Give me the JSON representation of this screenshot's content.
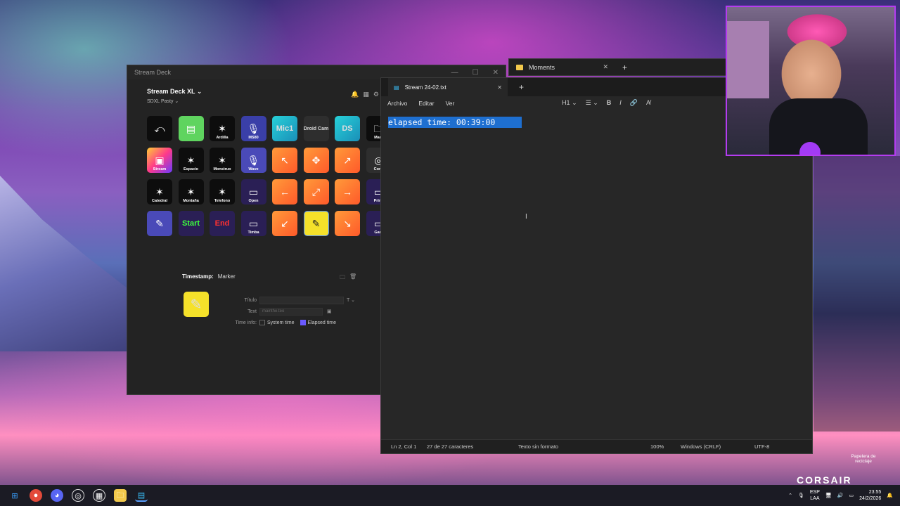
{
  "streamdeck": {
    "window_title": "Stream Deck",
    "device": "Stream Deck XL",
    "profile": "SDXL Pasty",
    "keys": [
      {
        "label": "",
        "icon": "back-icon",
        "glyph": "⤺"
      },
      {
        "label": "",
        "icon": "document-icon",
        "glyph": "▤"
      },
      {
        "label": "Ardilla",
        "icon": "corsair-icon",
        "glyph": "✶"
      },
      {
        "label": "MS80",
        "icon": "microphone-icon",
        "glyph": "🎙"
      },
      {
        "label": "",
        "icon": "mic-text",
        "glyph": "Mic1"
      },
      {
        "label": "",
        "icon": "droidcam-text",
        "glyph": "Droid Cam"
      },
      {
        "label": "",
        "icon": "ds-text",
        "glyph": "DS"
      },
      {
        "label": "Marv",
        "icon": "folder-icon",
        "glyph": "🗀"
      },
      {
        "label": "Stream",
        "icon": "twitch-icon",
        "glyph": "▣"
      },
      {
        "label": "Espacio",
        "icon": "corsair-icon",
        "glyph": "✶"
      },
      {
        "label": "Monstruo",
        "icon": "corsair-icon",
        "glyph": "✶"
      },
      {
        "label": "Wave",
        "icon": "microphone-icon",
        "glyph": "🎙"
      },
      {
        "label": "",
        "icon": "arrow-up-left-icon",
        "glyph": "↖"
      },
      {
        "label": "",
        "icon": "shrink-icon",
        "glyph": "✥"
      },
      {
        "label": "",
        "icon": "arrow-up-right-icon",
        "glyph": "↗"
      },
      {
        "label": "Cons",
        "icon": "camera-icon",
        "glyph": "◎"
      },
      {
        "label": "Catedral",
        "icon": "corsair-icon",
        "glyph": "✶"
      },
      {
        "label": "Montaña",
        "icon": "corsair-icon",
        "glyph": "✶"
      },
      {
        "label": "Telefono",
        "icon": "corsair-icon",
        "glyph": "✶"
      },
      {
        "label": "Open",
        "icon": "monitor-icon",
        "glyph": "▭"
      },
      {
        "label": "",
        "icon": "arrow-left-icon",
        "glyph": "←"
      },
      {
        "label": "",
        "icon": "expand-icon",
        "glyph": "⤢"
      },
      {
        "label": "",
        "icon": "arrow-right-icon",
        "glyph": "→"
      },
      {
        "label": "Princ",
        "icon": "monitor-icon",
        "glyph": "▭"
      },
      {
        "label": "",
        "icon": "pen-off-icon",
        "glyph": "✎"
      },
      {
        "label": "",
        "icon": "start-text",
        "glyph": "Start"
      },
      {
        "label": "",
        "icon": "end-text",
        "glyph": "End"
      },
      {
        "label": "Timba",
        "icon": "monitor-icon",
        "glyph": "▭"
      },
      {
        "label": "",
        "icon": "arrow-down-left-icon",
        "glyph": "↙"
      },
      {
        "label": "",
        "icon": "marker-icon",
        "glyph": "✎"
      },
      {
        "label": "",
        "icon": "arrow-down-right-icon",
        "glyph": "↘"
      },
      {
        "label": "Gam",
        "icon": "monitor-icon",
        "glyph": "▭"
      }
    ],
    "timestamp_label": "Timestamp:",
    "timestamp_value": "Marker",
    "form": {
      "title_label": "Título",
      "text_label": "Text",
      "text_placeholder": "mainthe.teo",
      "timeinfo_label": "Time info:",
      "system_time": "System time",
      "elapsed_time": "Elapsed time"
    }
  },
  "moments": {
    "title": "Moments"
  },
  "notepad": {
    "tab_title": "Stream 24-02.txt",
    "menu": [
      "Archivo",
      "Editar",
      "Ver"
    ],
    "heading_tool": "H1",
    "content": "elapsed time: 00:39:00",
    "status": {
      "position": "Ln 2, Col 1",
      "chars": "27 de 27 caracteres",
      "format": "Texto sin formato",
      "zoom": "100%",
      "eol": "Windows (CRLF)",
      "encoding": "UTF-8"
    }
  },
  "desktop": {
    "recycle_bin": "Papelera de reciclaje",
    "brand": "CORSAIR"
  },
  "taskbar": {
    "lang_top": "ESP",
    "lang_bottom": "LAA",
    "time": "23:55",
    "date": "24/2/2026"
  }
}
